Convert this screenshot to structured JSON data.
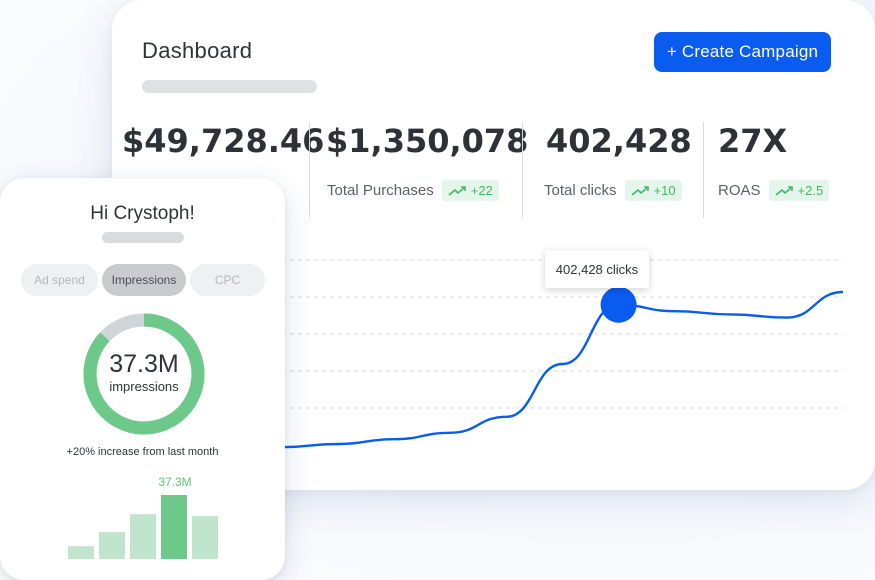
{
  "dashboard": {
    "title": "Dashboard",
    "create_button": "+ Create Campaign",
    "metrics": [
      {
        "value": "$49,728.46",
        "label": "",
        "delta": ""
      },
      {
        "value": "$1,350,078",
        "label": "Total Purchases",
        "delta": "+22"
      },
      {
        "value": "402,428",
        "label": "Total clicks",
        "delta": "+10"
      },
      {
        "value": "27X",
        "label": "ROAS",
        "delta": "+2.5"
      }
    ],
    "tooltip": "402,428 clicks"
  },
  "side": {
    "greeting": "Hi Crystoph!",
    "tabs": [
      {
        "label": "Ad spend",
        "active": false
      },
      {
        "label": "Impressions",
        "active": true
      },
      {
        "label": "CPC",
        "active": false
      }
    ],
    "donut_value": "37.3M",
    "donut_label": "impressions",
    "donut_fraction": 0.87,
    "increase_text": "+20% increase from last month",
    "bar_highlight_label": "37.3M"
  },
  "chart_data": [
    {
      "type": "line",
      "title": "",
      "xlabel": "",
      "ylabel": "",
      "x": [
        0,
        1,
        2,
        3,
        4,
        5,
        6,
        7,
        8,
        9,
        10
      ],
      "series": [
        {
          "values": [
            0.03,
            0.05,
            0.08,
            0.12,
            0.22,
            0.55,
            0.92,
            0.88,
            0.86,
            0.84,
            1.0
          ]
        }
      ],
      "highlight_index": 6,
      "grid": true,
      "colors": {
        "line": "#0a5cf0"
      }
    },
    {
      "type": "bar",
      "categories": [
        "1",
        "2",
        "3",
        "4",
        "5"
      ],
      "values": [
        0.2,
        0.42,
        0.7,
        1.0,
        0.67
      ],
      "highlight_index": 3,
      "colors": {
        "bar": "#bfe6cc",
        "highlight": "#6cc98a"
      }
    }
  ],
  "colors": {
    "accent": "#0a5cf0",
    "positive": "#43b86a",
    "donut": "#6cc98a",
    "donut_track": "#cfd6d9"
  }
}
